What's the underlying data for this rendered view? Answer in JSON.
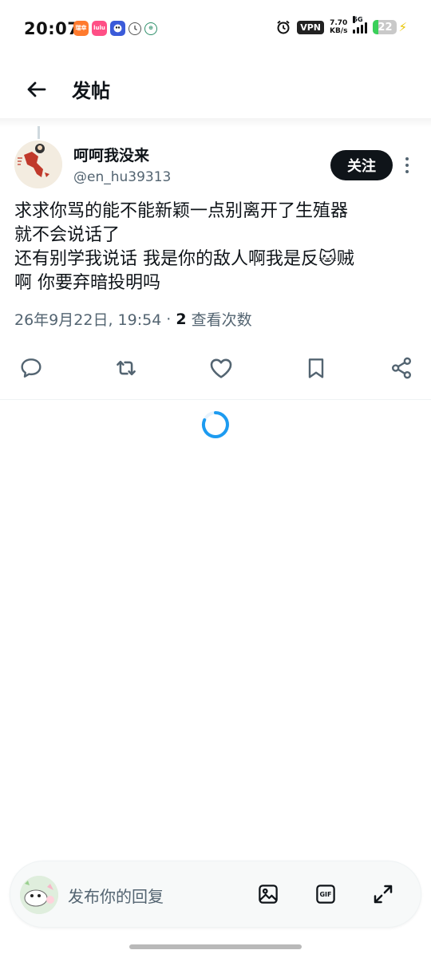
{
  "status_bar": {
    "time": "20:07",
    "app_icons": [
      {
        "name": "news-app-icon",
        "text": "瑞幸"
      },
      {
        "name": "lulu-app-icon",
        "text": "lulu"
      },
      {
        "name": "game-app-icon",
        "text": ""
      },
      {
        "name": "clock-app-icon",
        "text": ""
      },
      {
        "name": "wallet-app-icon",
        "text": "⊕"
      }
    ],
    "vpn_label": "VPN",
    "net_speed_value": "7.70",
    "net_speed_unit": "KB/s",
    "network_type": "5G",
    "battery_level": "22",
    "battery_fraction": 0.22,
    "colors": {
      "battery_fill": "#3ad05a",
      "charging": "#e8c400"
    }
  },
  "header": {
    "title": "发帖",
    "back_icon": "arrow-left-icon"
  },
  "tweet": {
    "author_name": "呵呵我没来",
    "author_handle": "@en_hu39313",
    "follow_label": "关注",
    "text_lines": [
      "求求你骂的能不能新颖一点别离开了生殖器",
      "就不会说话了",
      "还有别学我说话  我是你的敌人啊我是反🐱贼",
      "啊 你要弃暗投明吗"
    ],
    "timestamp": "26年9月22日, 19:54",
    "separator": "·",
    "view_count": "2",
    "view_label": "查看次数"
  },
  "actions": [
    {
      "name": "reply-icon"
    },
    {
      "name": "retweet-icon"
    },
    {
      "name": "like-icon"
    },
    {
      "name": "bookmark-icon"
    },
    {
      "name": "share-icon"
    }
  ],
  "reply_bar": {
    "placeholder": "发布你的回复",
    "icons": [
      "image-icon",
      "gif-icon",
      "expand-icon"
    ],
    "gif_label": "GIF"
  },
  "colors": {
    "accent": "#1d9bf0",
    "text_primary": "#0f1419",
    "text_secondary": "#536471",
    "follow_button_bg": "#0f1419"
  }
}
